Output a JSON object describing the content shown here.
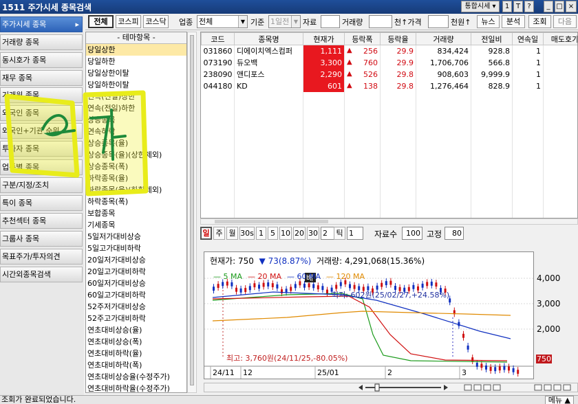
{
  "titlebar": {
    "title": "1511 주가시세 종목검색",
    "combined_label": "통합시세",
    "buttons": [
      "1",
      "T",
      "?"
    ]
  },
  "sidebar": {
    "items": [
      {
        "label": "주가시세 종목",
        "arrow": "▸"
      },
      {
        "label": "거래량 종목"
      },
      {
        "label": "동시호가 종목"
      },
      {
        "label": "재무 종목"
      },
      {
        "label": "거래원 종목"
      },
      {
        "label": "외국인 종목"
      },
      {
        "label": "외국인+기관 순위"
      },
      {
        "label": "투자자 종목"
      },
      {
        "label": "업종별 종목"
      },
      {
        "label": "구분/지정/조치"
      },
      {
        "label": "특이 종목"
      },
      {
        "label": "추천섹터 종목"
      },
      {
        "label": "그룹사 종목"
      },
      {
        "label": "목표주가/투자의견"
      },
      {
        "label": "시간외종목검색"
      }
    ]
  },
  "toolbar": {
    "market_all": "전체",
    "market_kospi": "코스피",
    "market_kosdaq": "코스닥",
    "sector_label": "업종",
    "sector_value": "전체",
    "basis_label": "기준",
    "basis_value": "1일전",
    "data_label": "자료",
    "volume_label": "거래량",
    "thousand_label": "천↑가격",
    "won_label": "천원↑",
    "news": "뉴스",
    "analysis": "분석",
    "query": "조회",
    "next": "다음"
  },
  "theme": {
    "header": "- 테마항목 -",
    "items": [
      "당일상한",
      "당일하한",
      "당일상한이탈",
      "당일하한이탈",
      "연속(전일)상한",
      "연속(전일)하한",
      "상승종목",
      "연속하락",
      "상승종목(율)",
      "상승종목(율)(상한제외)",
      "상승종목(폭)",
      "하락종목(율)",
      "하락종목(율)(하한제외)",
      "하락종목(폭)",
      "보합종목",
      "기세종목",
      "5일저가대비상승",
      "5일고가대비하락",
      "20일저가대비상승",
      "20일고가대비하락",
      "60일저가대비상승",
      "60일고가대비하락",
      "52주저가대비상승",
      "52주고가대비하락",
      "연초대비상승(율)",
      "연초대비상승(폭)",
      "연초대비하락(율)",
      "연초대비하락(폭)",
      "연초대비상승율(수정주가)",
      "연초대비하락율(수정주가)"
    ],
    "selected_index": 0
  },
  "grid": {
    "headers": [
      "코드",
      "종목명",
      "현재가",
      "등락폭",
      "등락율",
      "거래량",
      "전일비",
      "연속일",
      "매도호가"
    ],
    "rows": [
      [
        "031860",
        "디에이치엑스컴퍼",
        "1,111",
        "256",
        "29.9",
        "834,424",
        "928.8",
        "1",
        ""
      ],
      [
        "073190",
        "듀오백",
        "3,300",
        "760",
        "29.9",
        "1,706,706",
        "566.8",
        "1",
        ""
      ],
      [
        "238090",
        "앤디포스",
        "2,290",
        "526",
        "29.8",
        "908,603",
        "9,999.9",
        "1",
        ""
      ],
      [
        "044180",
        "KD",
        "601",
        "138",
        "29.8",
        "1,276,464",
        "828.9",
        "1",
        ""
      ]
    ]
  },
  "chart_toolbar": {
    "periods": [
      "일",
      "주",
      "월",
      "30s",
      "1",
      "5",
      "10",
      "20",
      "30",
      "2"
    ],
    "tick_label": "틱",
    "tick_value": "1",
    "count_label": "자료수",
    "count_value": "100",
    "fixed_label": "고정",
    "fixed_value": "80"
  },
  "chart": {
    "info_price": "현재가: 750",
    "info_change": "▼ 73(8.87%)",
    "info_volume": "거래량: 4,291,068(15.36%)",
    "legend": [
      {
        "name": "5 MA",
        "color": "#1a9a1a"
      },
      {
        "name": "20 MA",
        "color": "#d01010"
      },
      {
        "name": "60 MA",
        "color": "#1030c0"
      },
      {
        "name": "120 MA",
        "color": "#e08a00"
      }
    ],
    "max_label": "최고: 3,760원(24/11/25,-80.05%)",
    "low_label": "최저: 602원(25/02/27,+24.58%)",
    "marker": "배",
    "current_price": "750",
    "x_labels": [
      "24/11",
      "12",
      "25/01",
      "2",
      "3"
    ],
    "y_labels": [
      "4,000",
      "3,000",
      "2,000"
    ]
  },
  "status": {
    "text": "조회가 완료되었습니다.",
    "menu": "메뉴 ▲"
  },
  "annotation": {
    "text": "4개"
  }
}
